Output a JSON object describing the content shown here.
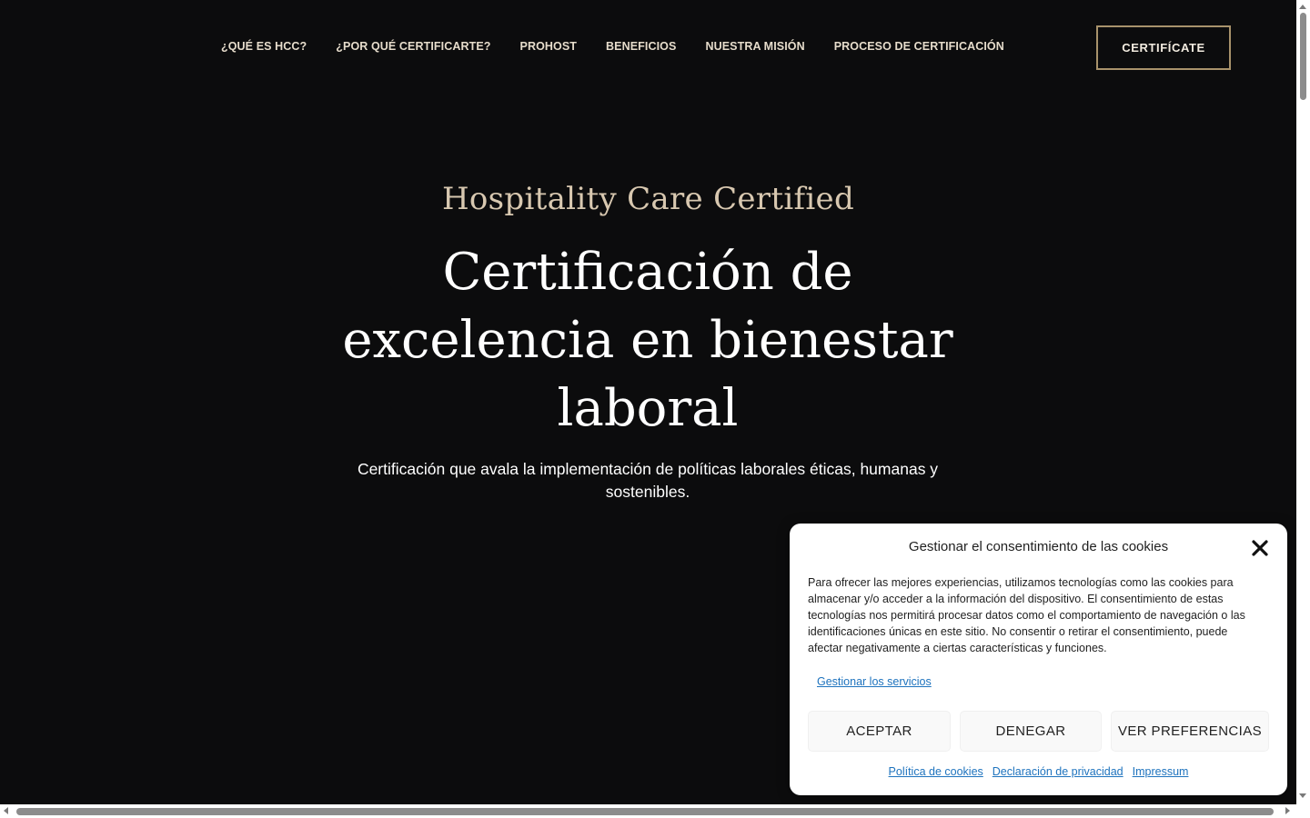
{
  "nav": {
    "items": [
      {
        "label": "¿QUÉ ES HCC?"
      },
      {
        "label": "¿POR QUÉ CERTIFICARTE?"
      },
      {
        "label": "PROHOST"
      },
      {
        "label": "BENEFICIOS"
      },
      {
        "label": "NUESTRA MISIÓN"
      },
      {
        "label": "PROCESO DE CERTIFICACIÓN"
      }
    ],
    "cta_label": "CERTIFÍCATE"
  },
  "hero": {
    "eyebrow": "Hospitality Care Certified",
    "title": "Certificación de excelencia en bienestar laboral",
    "subtitle": "Certificación que avala la implementación de políticas laborales éticas, humanas y sostenibles."
  },
  "cookie_banner": {
    "title": "Gestionar el consentimiento de las cookies",
    "body": "Para ofrecer las mejores experiencias, utilizamos tecnologías como las cookies para almacenar y/o acceder a la información del dispositivo. El consentimiento de estas tecnologías nos permitirá procesar datos como el comportamiento de navegación o las identificaciones únicas en este sitio. No consentir o retirar el consentimiento, puede afectar negativamente a ciertas características y funciones.",
    "manage_services_label": "Gestionar los servicios",
    "accept_label": "ACEPTAR",
    "deny_label": "DENEGAR",
    "preferences_label": "VER PREFERENCIAS",
    "links": {
      "cookie_policy": "Política de cookies",
      "privacy_statement": "Declaración de privacidad",
      "impressum": "Impressum"
    },
    "close_icon": "close-icon"
  },
  "colors": {
    "background": "#0c0c0d",
    "accent_gold": "#a8926b",
    "eyebrow_beige": "#d8c8b0",
    "link_blue": "#1e73be"
  }
}
